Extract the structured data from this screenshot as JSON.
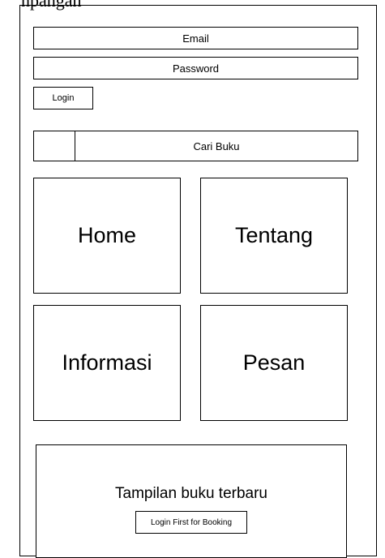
{
  "header": {
    "caption": "npangan"
  },
  "auth": {
    "email_label": "Email",
    "password_label": "Password",
    "login_label": "Login"
  },
  "search": {
    "label": "Cari Buku"
  },
  "menu": {
    "tiles": [
      {
        "label": "Home"
      },
      {
        "label": "Tentang"
      },
      {
        "label": "Informasi"
      },
      {
        "label": "Pesan"
      }
    ]
  },
  "latest": {
    "title": "Tampilan buku terbaru",
    "booking_label": "Login First for Booking"
  }
}
